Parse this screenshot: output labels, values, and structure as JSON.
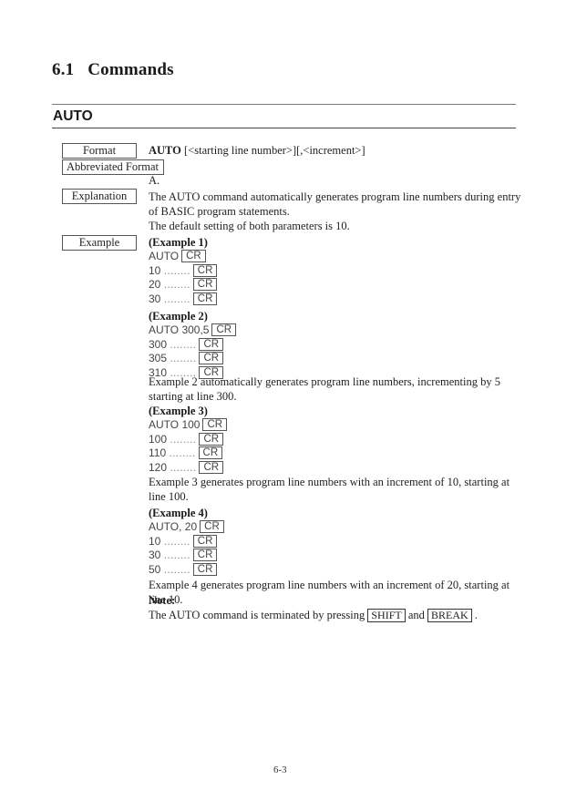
{
  "section": {
    "number": "6.1",
    "title": "Commands"
  },
  "command": {
    "name": "AUTO"
  },
  "labels": {
    "format": "Format",
    "abbreviated_format": "Abbreviated Format",
    "explanation": "Explanation",
    "example": "Example"
  },
  "format": {
    "keyword": "AUTO",
    "syntax": " [<starting line number>][,<increment>]"
  },
  "abbreviated_format": "A.",
  "explanation": {
    "line1": "The AUTO command automatically generates program line numbers during entry of BASIC program statements.",
    "line2": "The default setting of both parameters is 10."
  },
  "key_cr": "CR",
  "examples": [
    {
      "heading": "(Example 1)",
      "command": "AUTO",
      "lines": [
        "10 ",
        "20 ",
        "30 "
      ],
      "description": ""
    },
    {
      "heading": "(Example 2)",
      "command": "AUTO 300,5",
      "lines": [
        "300 ",
        "305 ",
        "310 "
      ],
      "description": "Example 2 automatically generates program line numbers, incrementing by 5 starting at line 300."
    },
    {
      "heading": "(Example 3)",
      "command": "AUTO 100",
      "lines": [
        "100 ",
        "110 ",
        "120 "
      ],
      "description": "Example 3 generates program line numbers with an increment of 10, starting at line 100."
    },
    {
      "heading": "(Example 4)",
      "command": "AUTO, 20",
      "lines": [
        "10 ",
        "30 ",
        "50 "
      ],
      "description": "Example 4 generates program line numbers with an increment of 20, starting at line 10."
    }
  ],
  "dots": "........",
  "note": {
    "heading": "Note:",
    "text_before": "The AUTO command is terminated by pressing ",
    "key1": "SHIFT",
    "text_between": " and ",
    "key2": "BREAK",
    "text_after": " ."
  },
  "page_number": "6-3"
}
